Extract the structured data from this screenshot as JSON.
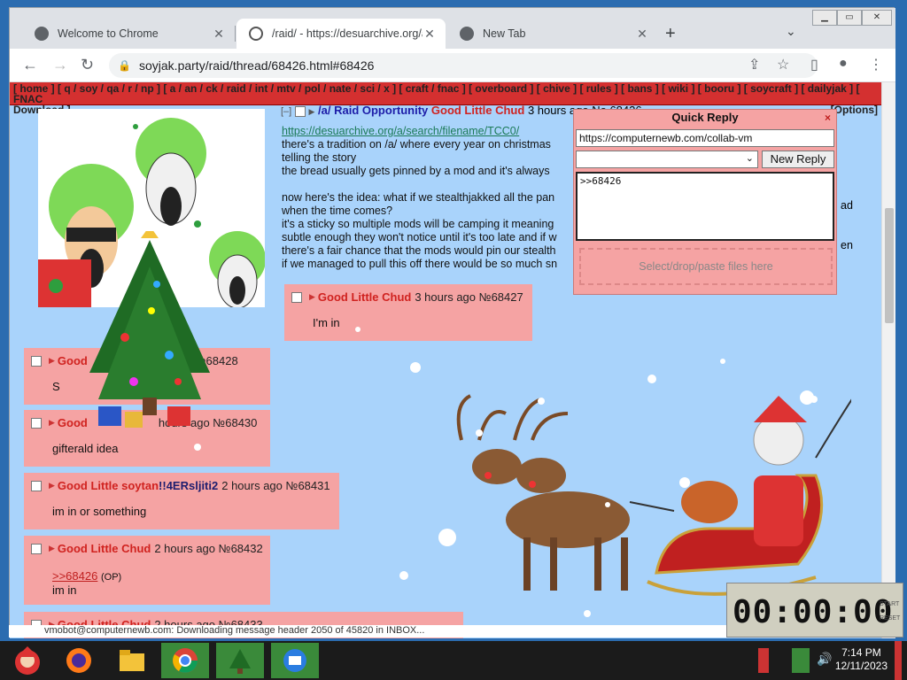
{
  "browser": {
    "tabs": [
      {
        "title": "Welcome to Chrome",
        "active": false
      },
      {
        "title": "/raid/ - https://desuarchive.org/a",
        "active": true
      },
      {
        "title": "New Tab",
        "active": false
      }
    ],
    "url": "soyjak.party/raid/thread/68426.html#68426",
    "new_tab_icon": "+"
  },
  "board_nav": {
    "line1": "[ home ] [ q / soy / qa / r / np ] [ a / an / ck / raid / int / mtv / pol / nate / sci / x ] [ craft / fnac ] [ overboard ] [ chive ] [ rules ] [ bans ] [ wiki ] [ booru ] [ soycraft ] [ dailyjak ] [ FNAC",
    "line2": "Download ]",
    "options": "[Options]"
  },
  "op": {
    "collapse": "[–]",
    "subject": "/a/ Raid Opportunity",
    "name": "Good Little Chud",
    "meta": "3 hours ago No.68426",
    "link": "https://desuarchive.org/a/search/filename/TCC0/",
    "lines": [
      "there's a tradition on /a/ where every year on christmas",
      "telling the story",
      "the bread usually gets pinned by a mod and it's always",
      "",
      "now here's the idea: what if we stealthjakked all the pan",
      "when the time comes?",
      "it's a sticky so multiple mods will be camping it meaning",
      "subtle enough they won't notice until it's too late and if w",
      "there's a fair chance that the mods would pin our stealth",
      "if we managed to pull this off there would be so much sn"
    ],
    "right_fragments": [
      "ad",
      "en"
    ]
  },
  "posts": [
    {
      "name": "Good Little Chud",
      "trip": "",
      "meta": "3 hours ago №68427",
      "body": "I'm in",
      "quote": ""
    },
    {
      "name": "Good",
      "trip": "",
      "meta": "rs ago №68428",
      "body": "S",
      "quote": ""
    },
    {
      "name": "Good",
      "trip": "",
      "meta": "hours ago №68430",
      "body": "gifterald idea",
      "quote": ""
    },
    {
      "name": "Good Little soytan",
      "trip": "!!4ERsljiti2",
      "meta": "2 hours ago №68431",
      "body": "im in or something",
      "quote": ""
    },
    {
      "name": "Good Little Chud",
      "trip": "",
      "meta": "2 hours ago №68432",
      "body": "im in",
      "quote": ">>68426",
      "quote_suffix": "(OP)"
    },
    {
      "name": "Good Little Chud",
      "trip": "",
      "meta": "2 hours ago №68433",
      "body": "",
      "quote": ""
    }
  ],
  "quick_reply": {
    "title": "Quick Reply",
    "close": "×",
    "name_value": "https://computernewb.com/collab-vm",
    "submit": "New Reply",
    "comment": ">>68426",
    "drop_text": "Select/drop/paste files here"
  },
  "timer": {
    "value": "00:00:00",
    "labels": [
      "START",
      "RESET"
    ]
  },
  "status_bar": "vmobot@computernewb.com: Downloading message header 2050 of 45820 in INBOX...",
  "clock": {
    "time": "7:14 PM",
    "date": "12/11/2023"
  }
}
